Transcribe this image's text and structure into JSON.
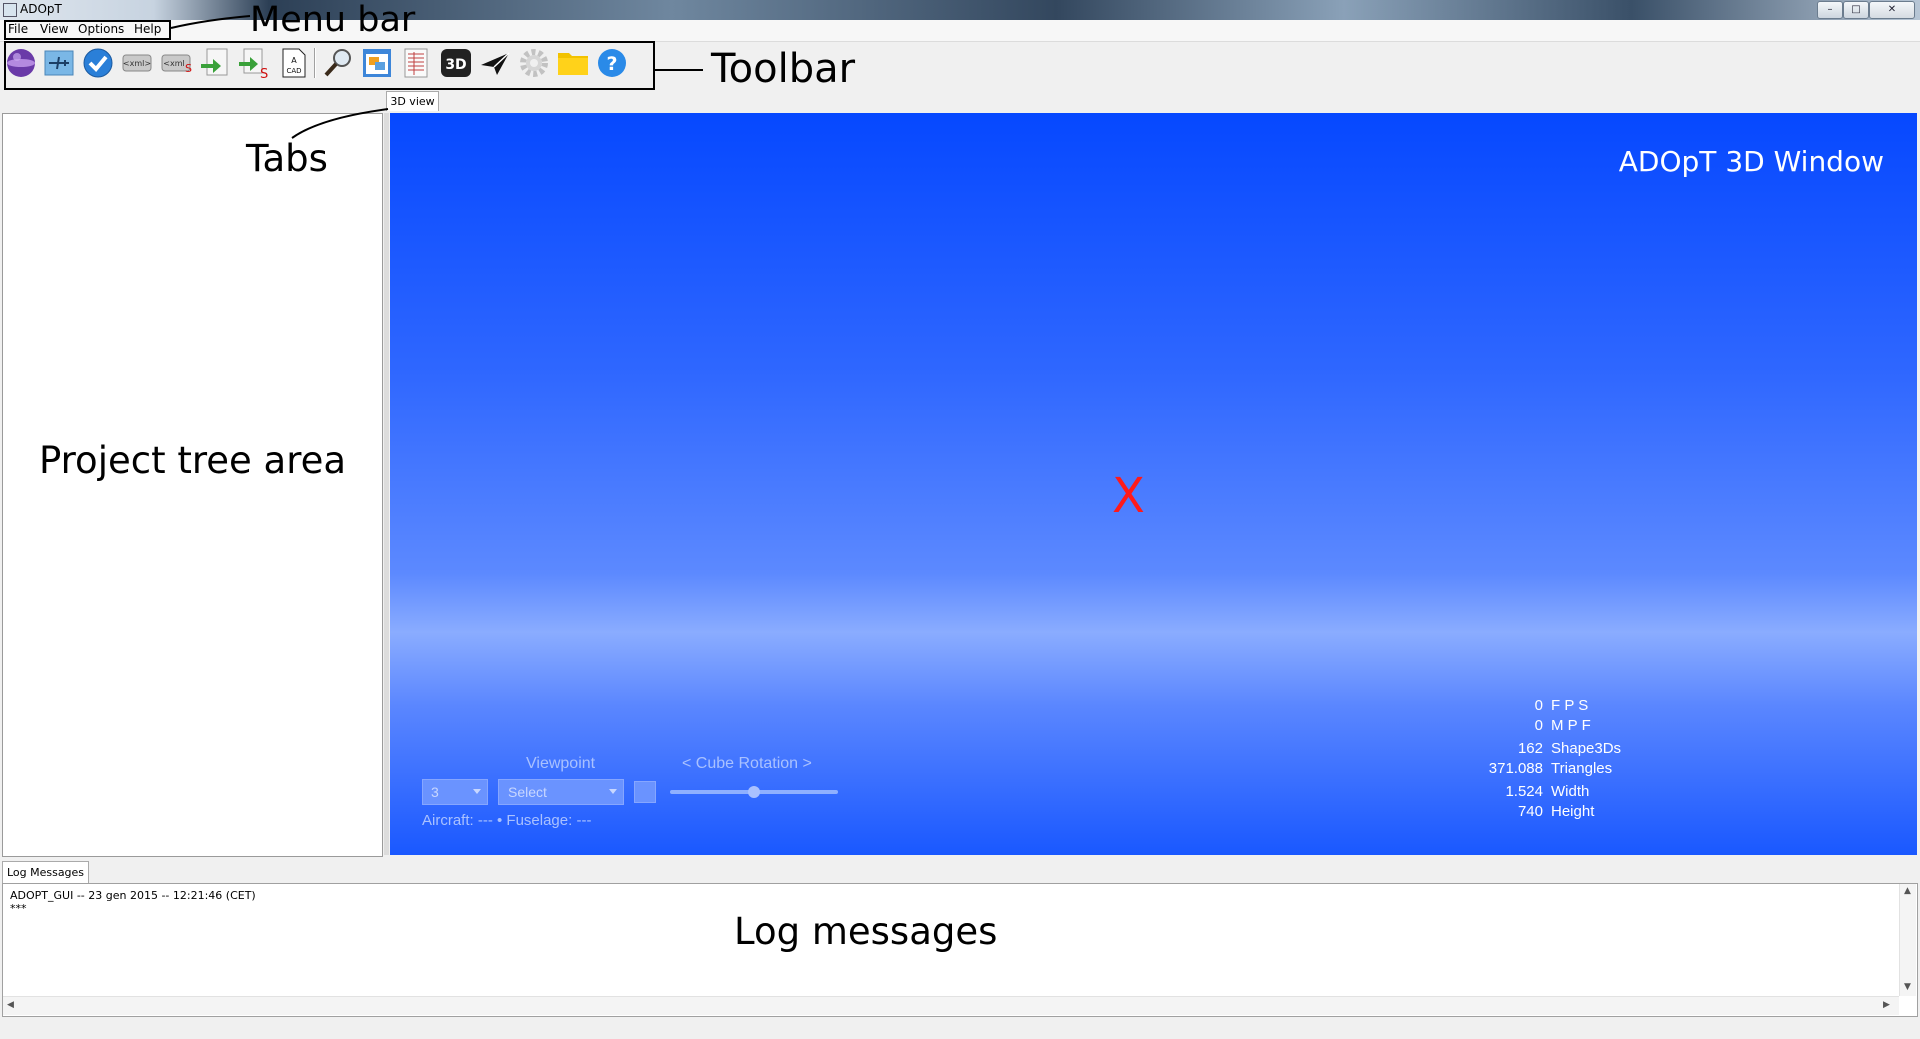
{
  "window": {
    "title": "ADOpT",
    "minimize": "–",
    "maximize": "□",
    "close": "✕"
  },
  "menu": {
    "items": [
      "File",
      "View",
      "Options",
      "Help"
    ]
  },
  "toolbar": {
    "buttons": [
      "sphere-icon",
      "aircraft-icon",
      "check-icon",
      "xml-icon",
      "xml-s-icon",
      "export-icon",
      "export-s-icon",
      "cad-icon",
      "search-icon",
      "window-icon",
      "table-icon",
      "3d-icon",
      "paper-plane-icon",
      "gear-icon",
      "folder-icon",
      "help-icon"
    ]
  },
  "annotations": {
    "menu_bar": "Menu bar",
    "toolbar": "Toolbar",
    "tabs": "Tabs",
    "project_tree": "Project tree area",
    "log_messages": "Log messages"
  },
  "tabs": {
    "view3d": "3D view",
    "log": "Log Messages"
  },
  "view3d": {
    "title": "ADOpT 3D Window",
    "center_marker": "X",
    "viewpoint_label": "Viewpoint",
    "cube_rotation_label": "<  Cube Rotation  >",
    "dropdown_value": "3",
    "select_value": "Select",
    "slider_level": 0.5,
    "aircraft_line": "Aircraft: ---  • Fuselage: ---",
    "stats": [
      {
        "value": "0",
        "label": "F P S"
      },
      {
        "value": "0",
        "label": "M P F"
      },
      {
        "value": "162",
        "label": "Shape3Ds"
      },
      {
        "value": "371.088",
        "label": "Triangles"
      },
      {
        "value": "1.524",
        "label": "Width"
      },
      {
        "value": "740",
        "label": "Height"
      }
    ]
  },
  "log": {
    "lines": [
      "ADOPT_GUI -- 23 gen 2015 -- 12:21:46 (CET)",
      "***"
    ]
  },
  "colors": {
    "accent": "#0648ff",
    "marker": "#ff1a1a"
  }
}
